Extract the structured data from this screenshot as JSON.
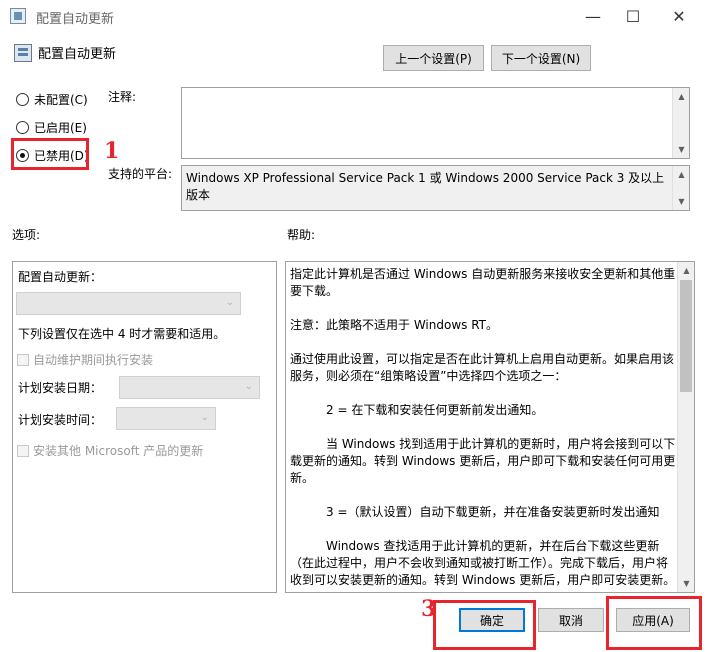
{
  "window": {
    "title": "配置自动更新",
    "minimize_label": "—",
    "maximize_label": "☐",
    "close_label": "✕"
  },
  "header": {
    "policy_title": "配置自动更新",
    "prev_setting_label": "上一个设置(P)",
    "next_setting_label": "下一个设置(N)"
  },
  "state_options": [
    {
      "label": "未配置(C)",
      "checked": false
    },
    {
      "label": "已启用(E)",
      "checked": false
    },
    {
      "label": "已禁用(D)",
      "checked": true
    }
  ],
  "comment": {
    "label": "注释:",
    "value": ""
  },
  "supported": {
    "label": "支持的平台:",
    "value": "Windows XP Professional Service Pack 1 或 Windows 2000 Service Pack 3 及以上版本"
  },
  "options_panel": {
    "label": "选项:",
    "configure_label": "配置自动更新：",
    "configure_value": "",
    "note": "下列设置仅在选中 4 时才需要和适用。",
    "maintenance_checkbox": "自动维护期间执行安装",
    "schedule_day_label": "计划安装日期：",
    "schedule_time_label": "计划安装时间：",
    "other_products_checkbox": "安装其他 Microsoft 产品的更新"
  },
  "help_panel": {
    "label": "帮助:",
    "paragraphs": [
      "指定此计算机是否通过 Windows 自动更新服务来接收安全更新和其他重要下载。",
      "注意：此策略不适用于 Windows RT。",
      "通过使用此设置，可以指定是否在此计算机上启用自动更新。如果启用该服务，则必须在“组策略设置”中选择四个选项之一：",
      "2 = 在下载和安装任何更新前发出通知。",
      "当 Windows 找到适用于此计算机的更新时，用户将会接到可以下载更新的通知。转到 Windows 更新后，用户即可下载和安装任何可用更新。",
      "3 =（默认设置）自动下载更新，并在准备安装更新时发出通知",
      "Windows 查找适用于此计算机的更新，并在后台下载这些更新（在此过程中，用户不会收到通知或被打断工作）。完成下载后，用户将收到可以安装更新的通知。转到 Windows 更新后，用户即可安装更新。"
    ]
  },
  "footer": {
    "ok_label": "确定",
    "cancel_label": "取消",
    "apply_label": "应用(A)"
  },
  "annotations": {
    "step1": "1",
    "step3": "3"
  },
  "colors": {
    "annotation_red": "#e8242c",
    "focus_blue": "#0078d7"
  }
}
